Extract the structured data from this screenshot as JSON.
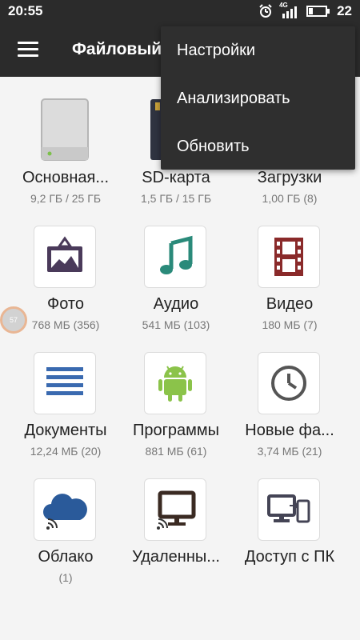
{
  "status_bar": {
    "time": "20:55",
    "network": "4G",
    "battery": "22"
  },
  "app_bar": {
    "title": "Файловый менеджер"
  },
  "overflow_menu": {
    "items": [
      "Настройки",
      "Анализировать",
      "Обновить"
    ]
  },
  "storage": [
    {
      "label": "Основная...",
      "info": "9,2 ГБ / 25 ГБ"
    },
    {
      "label": "SD-карта",
      "info": "1,5 ГБ / 15 ГБ"
    },
    {
      "label": "Загрузки",
      "info": "1,00 ГБ (8)"
    }
  ],
  "categories": [
    {
      "label": "Фото",
      "info": "768 МБ (356)"
    },
    {
      "label": "Аудио",
      "info": "541 МБ (103)"
    },
    {
      "label": "Видео",
      "info": "180 МБ (7)"
    },
    {
      "label": "Документы",
      "info": "12,24 МБ (20)"
    },
    {
      "label": "Программы",
      "info": "881 МБ (61)"
    },
    {
      "label": "Новые фа...",
      "info": "3,74 МБ (21)"
    },
    {
      "label": "Облако",
      "info": "(1)"
    },
    {
      "label": "Удаленны...",
      "info": ""
    },
    {
      "label": "Доступ с ПК",
      "info": ""
    }
  ],
  "floating_bubble": {
    "text": "57"
  },
  "colors": {
    "appbar": "#2b2b2b",
    "photo": "#4a3a5a",
    "audio": "#2a8a7a",
    "video": "#8a2a2a",
    "documents": "#3a6ab0",
    "apps": "#8bc34a",
    "recent": "#555555",
    "cloud": "#2a5a9a"
  }
}
